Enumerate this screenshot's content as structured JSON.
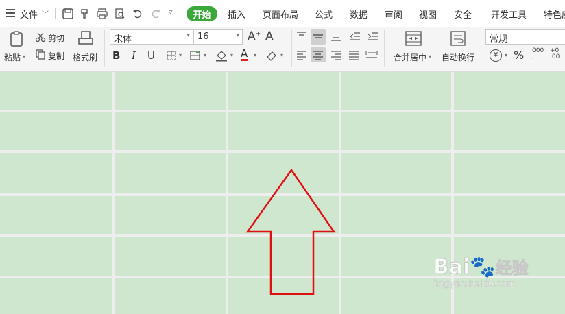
{
  "menubar": {
    "file_label": "文件",
    "tabs": [
      {
        "label": "开始",
        "active": true
      },
      {
        "label": "插入"
      },
      {
        "label": "页面布局"
      },
      {
        "label": "公式"
      },
      {
        "label": "数据"
      },
      {
        "label": "审阅"
      },
      {
        "label": "视图"
      },
      {
        "label": "安全"
      },
      {
        "label": "开发工具"
      },
      {
        "label": "特色应"
      }
    ],
    "accent_color": "#3ca83c"
  },
  "ribbon": {
    "paste_label": "粘贴",
    "cut_label": "剪切",
    "copy_label": "复制",
    "format_painter_label": "格式刷",
    "font_name": "宋体",
    "font_size": "16",
    "merge_center_label": "合并居中",
    "wrap_text_label": "自动换行",
    "number_format": "常规",
    "font_color": "#e02020"
  },
  "sheet": {
    "cell_fill_color": "#cfe7ce",
    "gridline_color": "#eeeeee",
    "annotation": "up-arrow",
    "annotation_color": "#e01010"
  },
  "watermark": {
    "brand": "Bai",
    "brand_suffix": "经验",
    "url": "jingyan.baidu.com"
  }
}
